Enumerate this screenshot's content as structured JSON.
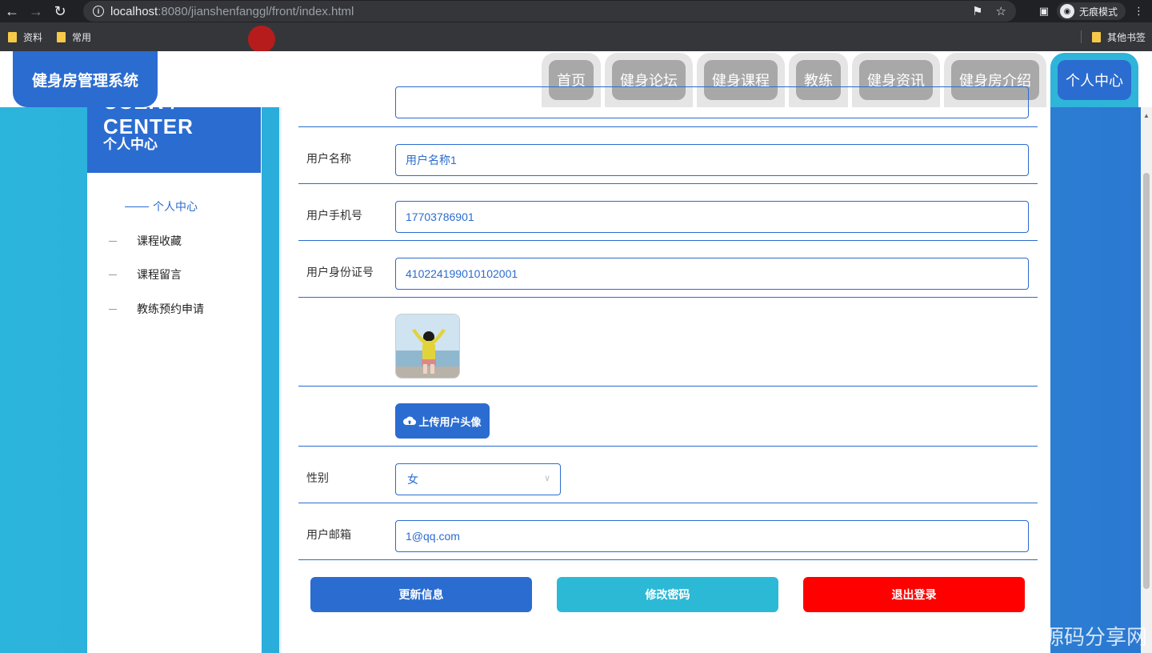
{
  "browser": {
    "url_host": "localhost",
    "url_rest": ":8080/jianshenfanggl/front/index.html",
    "incognito_label": "无痕模式",
    "bookmarks": [
      "资料",
      "常用"
    ],
    "other_bookmarks": "其他书签"
  },
  "header": {
    "logo": "健身房管理系统",
    "nav": [
      "首页",
      "健身论坛",
      "健身课程",
      "教练",
      "健身资讯",
      "健身房介绍",
      "个人中心"
    ],
    "active_nav": "个人中心"
  },
  "sidebar": {
    "title_en": "USER / CENTER",
    "title_cn": "个人中心",
    "items": [
      "个人中心",
      "课程收藏",
      "课程留言",
      "教练预约申请"
    ]
  },
  "form": {
    "username_label": "用户名称",
    "username_value": "用户名称1",
    "phone_label": "用户手机号",
    "phone_value": "17703786901",
    "idcard_label": "用户身份证号",
    "idcard_value": "410224199010102001",
    "upload_label": "上传用户头像",
    "gender_label": "性别",
    "gender_value": "女",
    "email_label": "用户邮箱",
    "email_value": "1@qq.com"
  },
  "buttons": {
    "update": "更新信息",
    "change_password": "修改密码",
    "logout": "退出登录"
  },
  "colors": {
    "primary": "#2b6cd0",
    "accent": "#2cb9d6",
    "danger": "#ff0000"
  },
  "watermark": "CSDN @程序猿毕设源码分享网"
}
